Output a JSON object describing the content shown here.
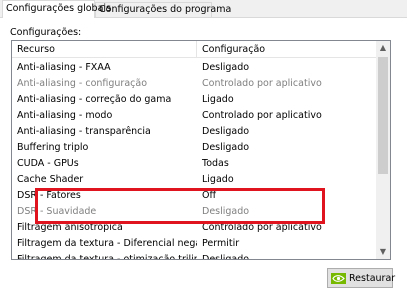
{
  "tabs": [
    {
      "label": "Configurações globais"
    },
    {
      "label": "Configurações do programa"
    }
  ],
  "section_label": "Configurações:",
  "columns": {
    "feature": "Recurso",
    "setting": "Configuração"
  },
  "rows": [
    {
      "feature": "Anti-aliasing - FXAA",
      "setting": "Desligado"
    },
    {
      "feature": "Anti-aliasing - configuração",
      "setting": "Controlado por aplicativo"
    },
    {
      "feature": "Anti-aliasing - correção do gama",
      "setting": "Ligado"
    },
    {
      "feature": "Anti-aliasing - modo",
      "setting": "Controlado por aplicativo"
    },
    {
      "feature": "Anti-aliasing - transparência",
      "setting": "Desligado"
    },
    {
      "feature": "Buffering triplo",
      "setting": "Desligado"
    },
    {
      "feature": "CUDA - GPUs",
      "setting": "Todas"
    },
    {
      "feature": "Cache Shader",
      "setting": "Ligado"
    },
    {
      "feature": "DSR - Fatores",
      "setting": "Off"
    },
    {
      "feature": "DSR - Suavidade",
      "setting": "Desligado"
    },
    {
      "feature": "Filtragem anisotrópica",
      "setting": "Controlado por aplicativo"
    },
    {
      "feature": "Filtragem da textura - Diferencial negativo...",
      "setting": "Permitir"
    },
    {
      "feature": "Filtragem da textura - otimização trilinear",
      "setting": "Desligado"
    }
  ],
  "restore_button": {
    "label": "Restaurar"
  },
  "colors": {
    "highlight": "#e0141e",
    "disabled_text": "#7f7f7f",
    "brand": "#76b900"
  },
  "icons": {
    "scroll_up": "chevron-up-icon",
    "scroll_down": "chevron-down-icon",
    "restore": "nvidia-logo-icon"
  }
}
